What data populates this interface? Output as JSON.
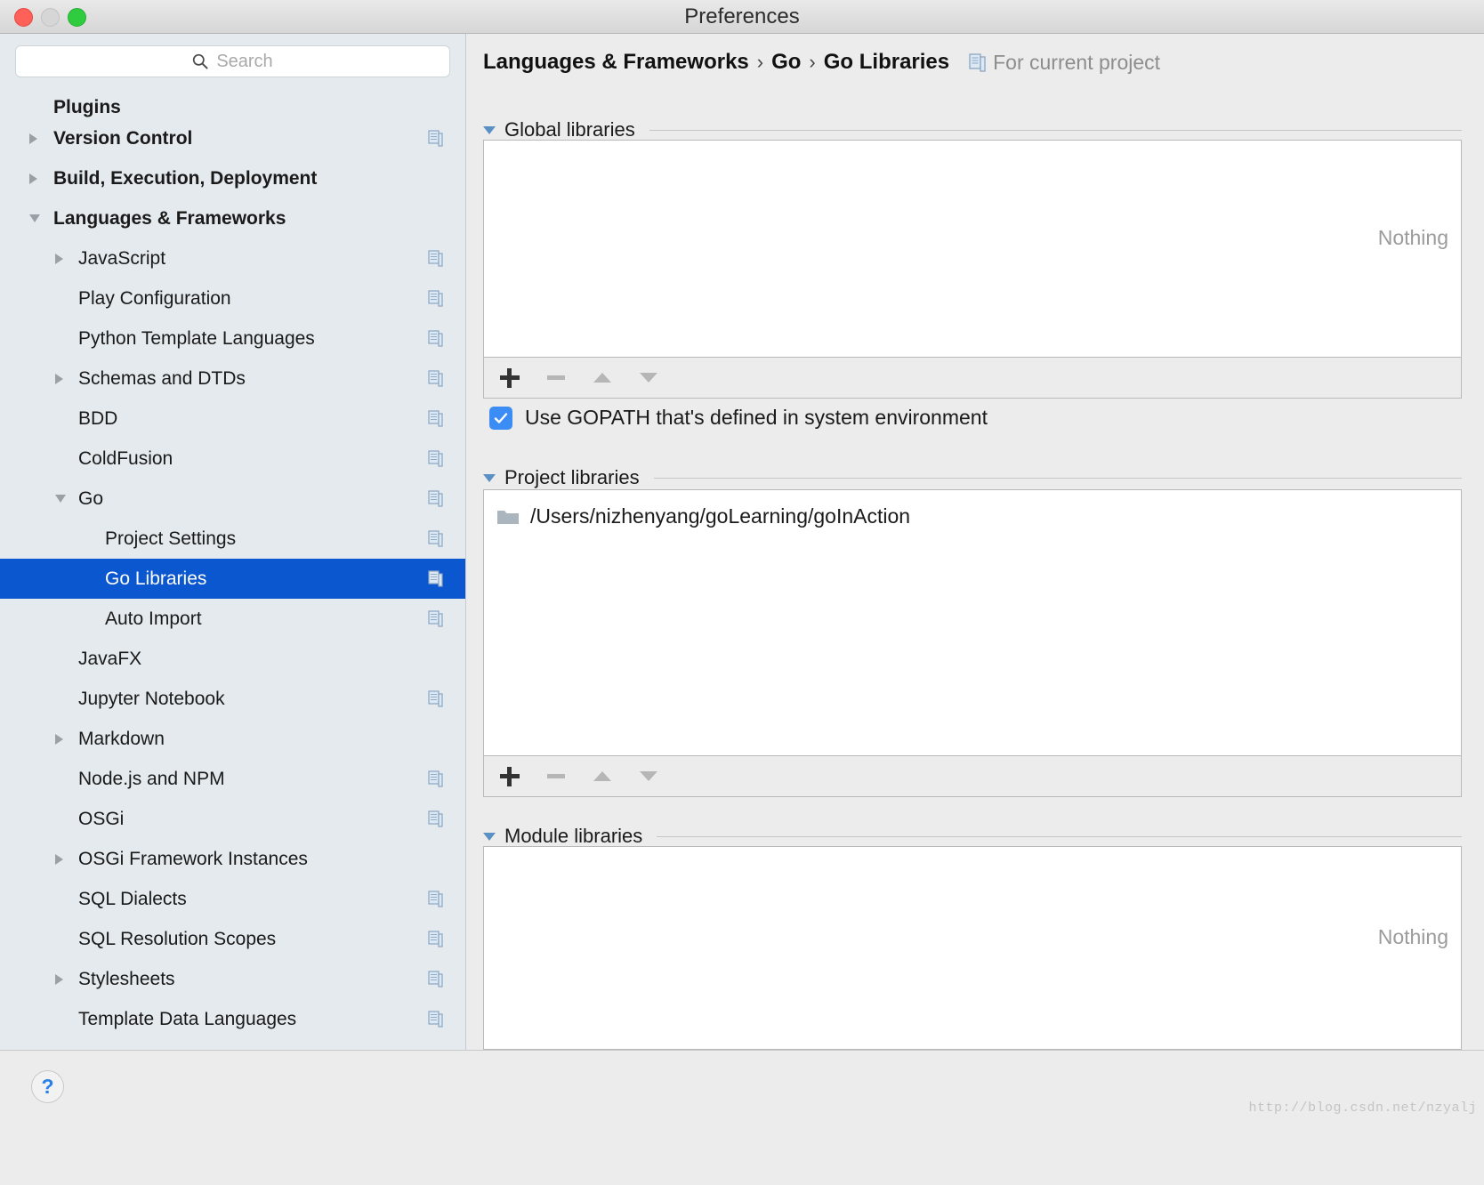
{
  "window": {
    "title": "Preferences",
    "traffic_lights": [
      "close",
      "minimize",
      "zoom"
    ]
  },
  "sidebar": {
    "search": {
      "placeholder": "Search",
      "value": "",
      "icon": "search-icon"
    },
    "items": [
      {
        "label": "Plugins",
        "depth": 0,
        "bold": true,
        "arrow": "none",
        "copy": false,
        "selected": false,
        "clipped_top": true
      },
      {
        "label": "Version Control",
        "depth": 0,
        "bold": true,
        "arrow": "right",
        "copy": true,
        "selected": false
      },
      {
        "label": "Build, Execution, Deployment",
        "depth": 0,
        "bold": true,
        "arrow": "right",
        "copy": false,
        "selected": false
      },
      {
        "label": "Languages & Frameworks",
        "depth": 0,
        "bold": true,
        "arrow": "down",
        "copy": false,
        "selected": false
      },
      {
        "label": "JavaScript",
        "depth": 1,
        "bold": false,
        "arrow": "right",
        "copy": true,
        "selected": false
      },
      {
        "label": "Play Configuration",
        "depth": 1,
        "bold": false,
        "arrow": "none",
        "copy": true,
        "selected": false
      },
      {
        "label": "Python Template Languages",
        "depth": 1,
        "bold": false,
        "arrow": "none",
        "copy": true,
        "selected": false
      },
      {
        "label": "Schemas and DTDs",
        "depth": 1,
        "bold": false,
        "arrow": "right",
        "copy": true,
        "selected": false
      },
      {
        "label": "BDD",
        "depth": 1,
        "bold": false,
        "arrow": "none",
        "copy": true,
        "selected": false
      },
      {
        "label": "ColdFusion",
        "depth": 1,
        "bold": false,
        "arrow": "none",
        "copy": true,
        "selected": false
      },
      {
        "label": "Go",
        "depth": 1,
        "bold": false,
        "arrow": "down",
        "copy": true,
        "selected": false
      },
      {
        "label": "Project Settings",
        "depth": 2,
        "bold": false,
        "arrow": "none",
        "copy": true,
        "selected": false
      },
      {
        "label": "Go Libraries",
        "depth": 2,
        "bold": false,
        "arrow": "none",
        "copy": true,
        "selected": true
      },
      {
        "label": "Auto Import",
        "depth": 2,
        "bold": false,
        "arrow": "none",
        "copy": true,
        "selected": false
      },
      {
        "label": "JavaFX",
        "depth": 1,
        "bold": false,
        "arrow": "none",
        "copy": false,
        "selected": false
      },
      {
        "label": "Jupyter Notebook",
        "depth": 1,
        "bold": false,
        "arrow": "none",
        "copy": true,
        "selected": false
      },
      {
        "label": "Markdown",
        "depth": 1,
        "bold": false,
        "arrow": "right",
        "copy": false,
        "selected": false
      },
      {
        "label": "Node.js and NPM",
        "depth": 1,
        "bold": false,
        "arrow": "none",
        "copy": true,
        "selected": false
      },
      {
        "label": "OSGi",
        "depth": 1,
        "bold": false,
        "arrow": "none",
        "copy": true,
        "selected": false
      },
      {
        "label": "OSGi Framework Instances",
        "depth": 1,
        "bold": false,
        "arrow": "right",
        "copy": false,
        "selected": false
      },
      {
        "label": "SQL Dialects",
        "depth": 1,
        "bold": false,
        "arrow": "none",
        "copy": true,
        "selected": false
      },
      {
        "label": "SQL Resolution Scopes",
        "depth": 1,
        "bold": false,
        "arrow": "none",
        "copy": true,
        "selected": false
      },
      {
        "label": "Stylesheets",
        "depth": 1,
        "bold": false,
        "arrow": "right",
        "copy": true,
        "selected": false
      },
      {
        "label": "Template Data Languages",
        "depth": 1,
        "bold": false,
        "arrow": "none",
        "copy": true,
        "selected": false
      }
    ]
  },
  "breadcrumb": {
    "parts": [
      "Languages & Frameworks",
      "Go",
      "Go Libraries"
    ],
    "separator": "›",
    "scope_note": "For current project",
    "scope_icon": "copy-icon"
  },
  "sections": {
    "global": {
      "title": "Global libraries",
      "empty_text": "Nothing",
      "toolbar": [
        {
          "name": "add-button",
          "glyph": "plus",
          "enabled": true
        },
        {
          "name": "remove-button",
          "glyph": "minus",
          "enabled": false
        },
        {
          "name": "move-up-button",
          "glyph": "triangle-up",
          "enabled": false
        },
        {
          "name": "move-down-button",
          "glyph": "triangle-down",
          "enabled": false
        }
      ]
    },
    "gopath_checkbox": {
      "label": "Use GOPATH that's defined in system environment",
      "checked": true
    },
    "project": {
      "title": "Project libraries",
      "entries": [
        {
          "path": "/Users/nizhenyang/goLearning/goInAction",
          "icon": "folder-icon"
        }
      ],
      "toolbar": [
        {
          "name": "add-button",
          "glyph": "plus",
          "enabled": true
        },
        {
          "name": "remove-button",
          "glyph": "minus",
          "enabled": false
        },
        {
          "name": "move-up-button",
          "glyph": "triangle-up",
          "enabled": false
        },
        {
          "name": "move-down-button",
          "glyph": "triangle-down",
          "enabled": false
        }
      ]
    },
    "module": {
      "title": "Module libraries",
      "empty_text": "Nothing"
    }
  },
  "footer": {
    "help_label": "?",
    "watermark": "http://blog.csdn.net/nzyalj"
  },
  "colors": {
    "selection_blue": "#0b57d0",
    "checkbox_blue": "#3c8cf5",
    "sidebar_bg": "#e4eaee",
    "panel_bg": "#ececec",
    "traffic_red": "#ff6159",
    "traffic_green": "#2fcc3f"
  }
}
